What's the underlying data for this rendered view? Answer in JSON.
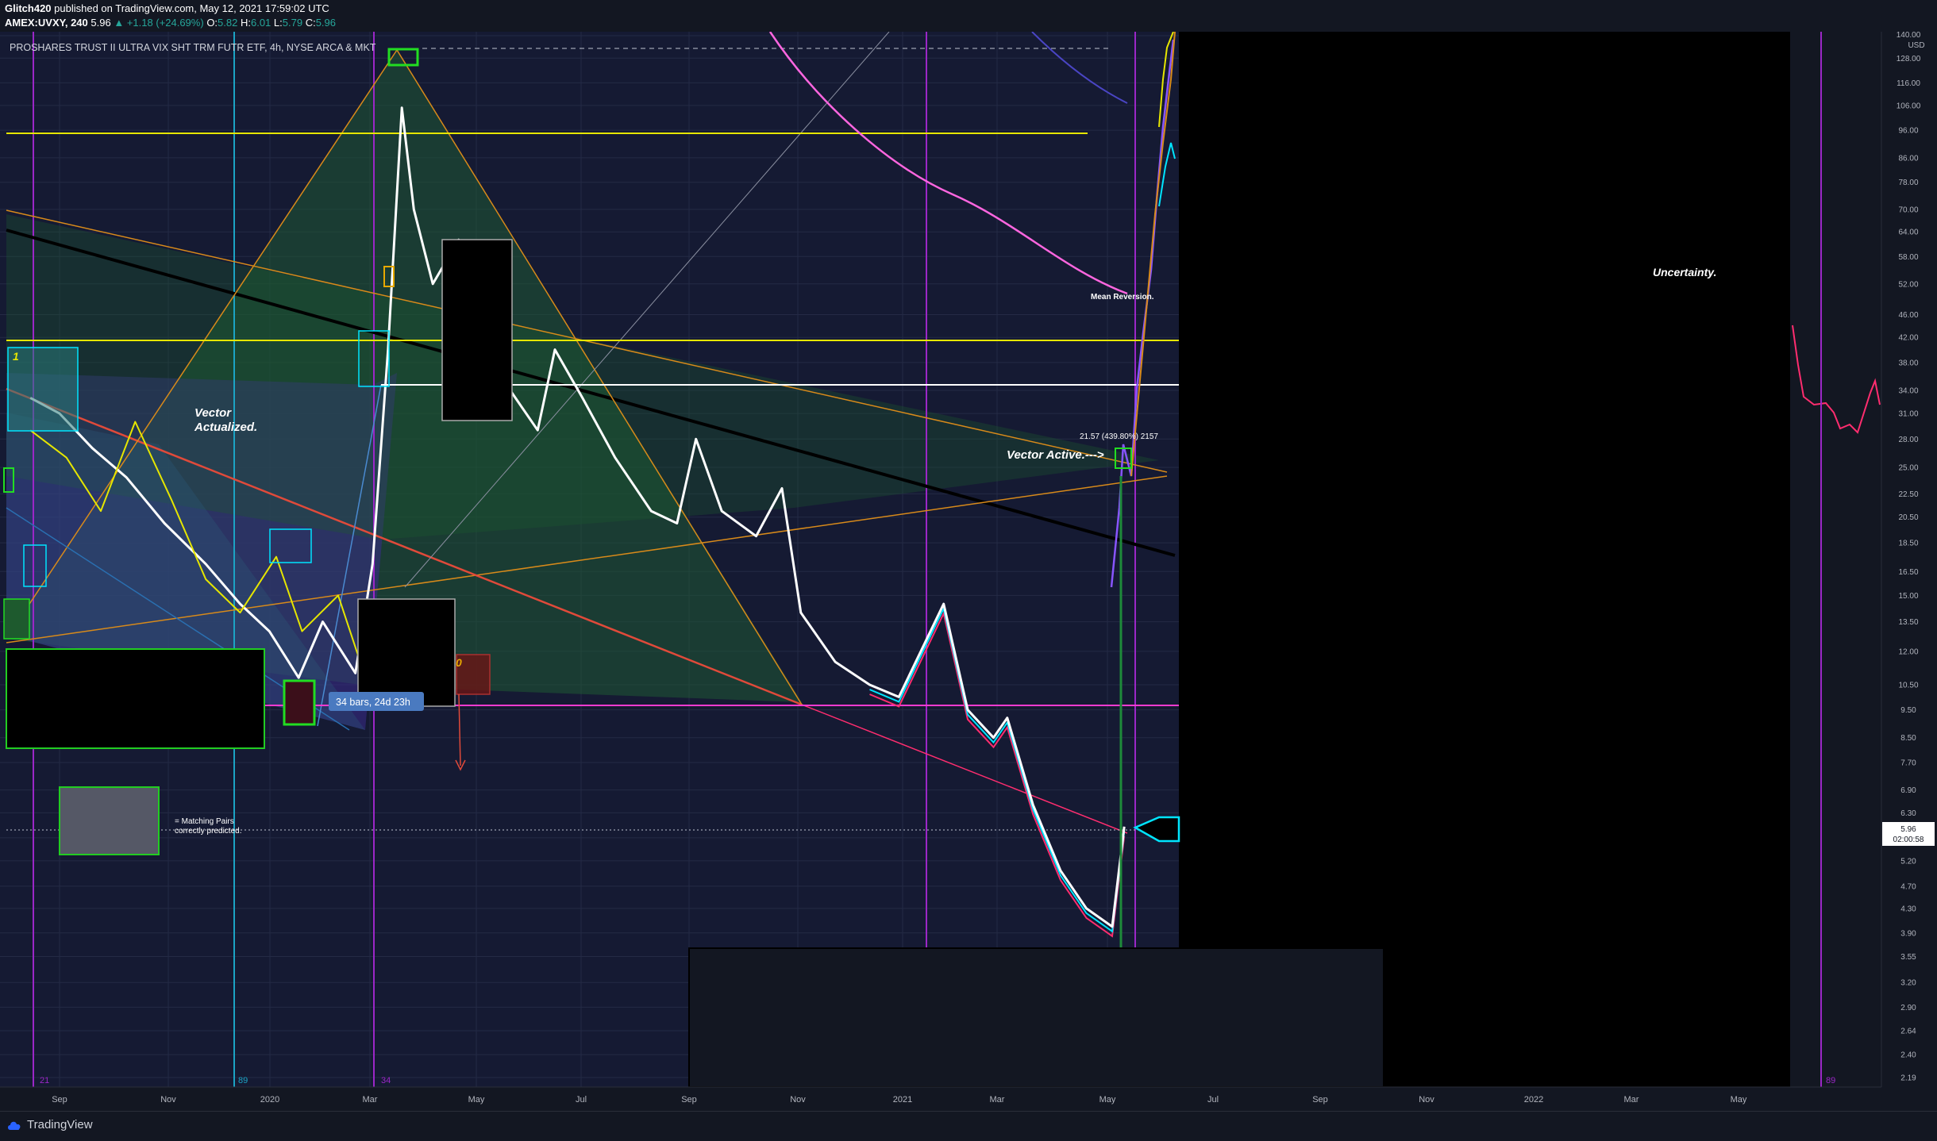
{
  "header": {
    "publisher": "Glitch420",
    "published_text": "published on TradingView.com, May 12, 2021 17:59:02 UTC",
    "symbol": "AMEX:UVXY, 240",
    "last": "5.96",
    "change": "+1.18 (+24.69%)",
    "ohlc_o_label": "O:",
    "ohlc_o": "5.82",
    "ohlc_h_label": "H:",
    "ohlc_h": "6.01",
    "ohlc_l_label": "L:",
    "ohlc_l": "5.79",
    "ohlc_c_label": "C:",
    "ohlc_c": "5.96"
  },
  "legend": {
    "title": "PROSHARES TRUST II ULTRA VIX SHT TRM FUTR ETF, 4h, NYSE ARCA & MKT"
  },
  "annotations": {
    "vector_actualized": [
      "Vector",
      "Actualized."
    ],
    "vector_active": "Vector Active.--->",
    "mean_reversion": "Mean Reversion.",
    "uncertainty": "Uncertainty.",
    "matching_pairs": [
      "= Matching Pairs",
      "correctly predicted."
    ],
    "bars_label": "34 bars, 24d 23h",
    "measure_label": "21.57 (439.80%) 2157",
    "count_1": "1",
    "count_0": "0",
    "cycle_21": "21",
    "cycle_89_a": "89",
    "cycle_34": "34",
    "cycle_89_b": "89"
  },
  "price_axis": {
    "currency": "USD",
    "current_price": "5.96",
    "countdown": "02:00:58"
  },
  "footer": {
    "brand": "TradingView"
  },
  "colors": {
    "background": "#131722",
    "price_line": "#ffffff",
    "overlay_yellow": "#e6e600",
    "cyan": "#00e5ff",
    "magenta": "#ff3bd1",
    "pink_red": "#ff2d6f",
    "purple": "#8855ff",
    "fib_green": "#1e5a2e",
    "orange": "#d88a1a"
  },
  "chart_data": {
    "type": "line",
    "title": "PROSHARES TRUST II ULTRA VIX SHT TRM FUTR ETF, 4h, NYSE ARCA & MKT",
    "y_scale": "log",
    "ylabel": "USD",
    "y_ticks": [
      "140.00",
      "128.00",
      "116.00",
      "106.00",
      "96.00",
      "86.00",
      "78.00",
      "70.00",
      "64.00",
      "58.00",
      "52.00",
      "46.00",
      "42.00",
      "38.00",
      "34.00",
      "31.00",
      "28.00",
      "25.00",
      "22.50",
      "20.50",
      "18.50",
      "16.50",
      "15.00",
      "13.50",
      "12.00",
      "10.50",
      "9.50",
      "8.50",
      "7.70",
      "6.90",
      "6.30",
      "5.70",
      "5.20",
      "4.70",
      "4.30",
      "3.90",
      "3.55",
      "3.20",
      "2.90",
      "2.64",
      "2.40",
      "2.19"
    ],
    "x_ticks": [
      "Sep",
      "Nov",
      "2020",
      "Mar",
      "May",
      "Jul",
      "Sep",
      "Nov",
      "2021",
      "Mar",
      "May",
      "Jul",
      "Sep",
      "Nov",
      "2022",
      "Mar",
      "May"
    ],
    "series": [
      {
        "color": "#ffffff",
        "points": [
          [
            "2019-08-15",
            33
          ],
          [
            "2019-09-01",
            31
          ],
          [
            "2019-09-20",
            27
          ],
          [
            "2019-10-10",
            24
          ],
          [
            "2019-11-01",
            20
          ],
          [
            "2019-11-25",
            17
          ],
          [
            "2019-12-15",
            14.5
          ],
          [
            "2020-01-01",
            13
          ],
          [
            "2020-01-18",
            10.8
          ],
          [
            "2020-02-01",
            13.5
          ],
          [
            "2020-02-20",
            11
          ],
          [
            "2020-03-01",
            17
          ],
          [
            "2020-03-10",
            40
          ],
          [
            "2020-03-18",
            105
          ],
          [
            "2020-03-25",
            70
          ],
          [
            "2020-04-05",
            52
          ],
          [
            "2020-04-20",
            62
          ],
          [
            "2020-05-01",
            42
          ],
          [
            "2020-05-20",
            34
          ],
          [
            "2020-06-05",
            29
          ],
          [
            "2020-06-15",
            40
          ],
          [
            "2020-07-01",
            33
          ],
          [
            "2020-07-20",
            26
          ],
          [
            "2020-08-10",
            21
          ],
          [
            "2020-08-25",
            20
          ],
          [
            "2020-09-05",
            28
          ],
          [
            "2020-09-20",
            21
          ],
          [
            "2020-10-10",
            19
          ],
          [
            "2020-10-25",
            23
          ],
          [
            "2020-11-05",
            14
          ],
          [
            "2020-11-25",
            11.5
          ],
          [
            "2020-12-15",
            10.5
          ],
          [
            "2021-01-01",
            10
          ],
          [
            "2021-01-27",
            14.5
          ],
          [
            "2021-02-10",
            9.5
          ],
          [
            "2021-02-25",
            8.5
          ],
          [
            "2021-03-05",
            9.2
          ],
          [
            "2021-03-20",
            6.5
          ],
          [
            "2021-04-05",
            5.0
          ],
          [
            "2021-04-20",
            4.3
          ],
          [
            "2021-05-05",
            4.0
          ],
          [
            "2021-05-12",
            5.96
          ]
        ]
      },
      {
        "color": "#e6e600",
        "points": [
          [
            "2019-08-15",
            29
          ],
          [
            "2019-09-05",
            26
          ],
          [
            "2019-09-25",
            21
          ],
          [
            "2019-10-15",
            30
          ],
          [
            "2019-11-05",
            22
          ],
          [
            "2019-11-25",
            16
          ],
          [
            "2019-12-15",
            14
          ],
          [
            "2020-01-05",
            17.5
          ],
          [
            "2020-01-20",
            13
          ],
          [
            "2020-02-10",
            15
          ],
          [
            "2020-02-25",
            11
          ]
        ]
      }
    ],
    "levels": [
      96,
      41.5,
      35,
      9.7,
      5.96
    ]
  }
}
